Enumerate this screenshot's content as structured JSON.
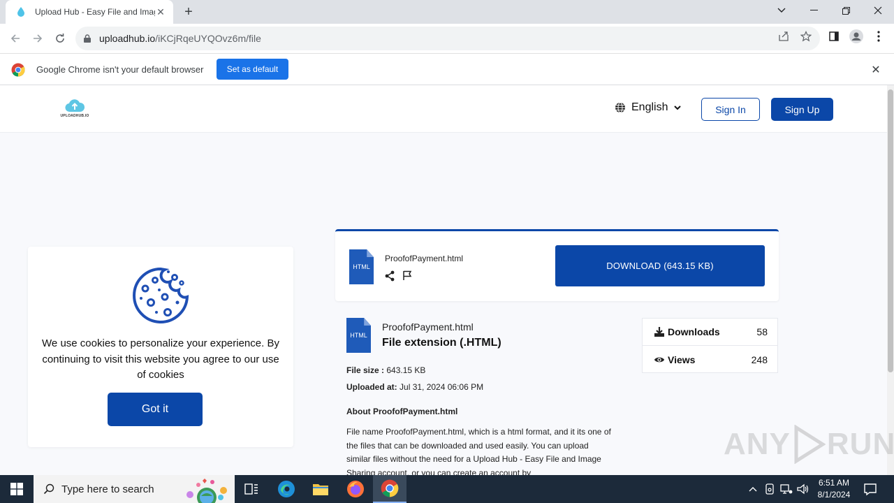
{
  "browser": {
    "tab_title": "Upload Hub - Easy File and Image Sharing",
    "url_host": "uploadhub.io",
    "url_path": "/iKCjRqeUYQOvz6m/file",
    "infobar_message": "Google Chrome isn't your default browser",
    "infobar_button": "Set as default"
  },
  "header": {
    "logo_text": "UPLOADHUB.IO",
    "language": "English",
    "signin_label": "Sign In",
    "signup_label": "Sign Up"
  },
  "download_card": {
    "file_type": "HTML",
    "file_name": "ProofofPayment.html",
    "download_label": "DOWNLOAD (643.15 KB)"
  },
  "details": {
    "file_type": "HTML",
    "file_name": "ProofofPayment.html",
    "extension": "File extension (.HTML)",
    "size_label": "File size :",
    "size_value": "643.15 KB",
    "uploaded_label": "Uploaded at:",
    "uploaded_value": "Jul 31, 2024 06:06 PM",
    "about_title": "About ProofofPayment.html",
    "about_text": "File name ProofofPayment.html, which is a html format, and it its one of the files that can be downloaded and used easily. You can upload similar files without the need for a Upload Hub - Easy File and Image Sharing account, or you can create an account by"
  },
  "stats": {
    "downloads_label": "Downloads",
    "downloads_value": "58",
    "views_label": "Views",
    "views_value": "248"
  },
  "cookie": {
    "text": "We use cookies to personalize your experience. By continuing to visit this website you agree to our use of cookies",
    "button": "Got it"
  },
  "watermark": {
    "left": "ANY",
    "right": "RUN"
  },
  "taskbar": {
    "search_placeholder": "Type here to search",
    "time": "6:51 AM",
    "date": "8/1/2024"
  },
  "colors": {
    "brand": "#0b47a8",
    "chrome_blue": "#1a73e8",
    "taskbar": "#1c2a3a"
  }
}
